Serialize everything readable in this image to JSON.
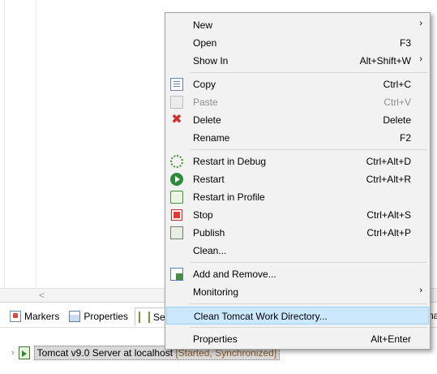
{
  "menu": {
    "items": [
      {
        "label": "New",
        "shortcut": "",
        "submenu": true
      },
      {
        "label": "Open",
        "shortcut": "F3"
      },
      {
        "label": "Show In",
        "shortcut": "Alt+Shift+W",
        "submenu": true
      },
      {
        "label": "Copy",
        "shortcut": "Ctrl+C",
        "icon": "copy-icon"
      },
      {
        "label": "Paste",
        "shortcut": "Ctrl+V",
        "icon": "paste-icon",
        "disabled": true
      },
      {
        "label": "Delete",
        "shortcut": "Delete",
        "icon": "delete-icon"
      },
      {
        "label": "Rename",
        "shortcut": "F2"
      },
      {
        "label": "Restart in Debug",
        "shortcut": "Ctrl+Alt+D",
        "icon": "debug-icon"
      },
      {
        "label": "Restart",
        "shortcut": "Ctrl+Alt+R",
        "icon": "restart-icon"
      },
      {
        "label": "Restart in Profile",
        "shortcut": "",
        "icon": "profile-icon"
      },
      {
        "label": "Stop",
        "shortcut": "Ctrl+Alt+S",
        "icon": "stop-icon"
      },
      {
        "label": "Publish",
        "shortcut": "Ctrl+Alt+P",
        "icon": "publish-icon"
      },
      {
        "label": "Clean...",
        "shortcut": ""
      },
      {
        "label": "Add and Remove...",
        "shortcut": "",
        "icon": "add-remove-icon"
      },
      {
        "label": "Monitoring",
        "shortcut": "",
        "submenu": true
      },
      {
        "label": "Clean Tomcat Work Directory...",
        "shortcut": "",
        "highlighted": true
      },
      {
        "label": "Properties",
        "shortcut": "Alt+Enter"
      }
    ],
    "submenu_arrow": "›"
  },
  "views": {
    "tabs": [
      {
        "label": "Markers",
        "icon": "markers-icon"
      },
      {
        "label": "Properties",
        "icon": "properties-icon"
      },
      {
        "label": "Ser",
        "icon": "servers-icon"
      }
    ],
    "right_fragment": "nal"
  },
  "server": {
    "label": "Tomcat v9.0 Server at localhost",
    "status": "[Started, Synchronized]",
    "expander": "›"
  },
  "editor": {
    "scroll_left_arrow": "<"
  },
  "colors": {
    "highlight_bg": "#cce8ff",
    "menu_bg": "#f2f2f2",
    "delete_red": "#d32f2f",
    "run_green": "#2e8b3a"
  }
}
